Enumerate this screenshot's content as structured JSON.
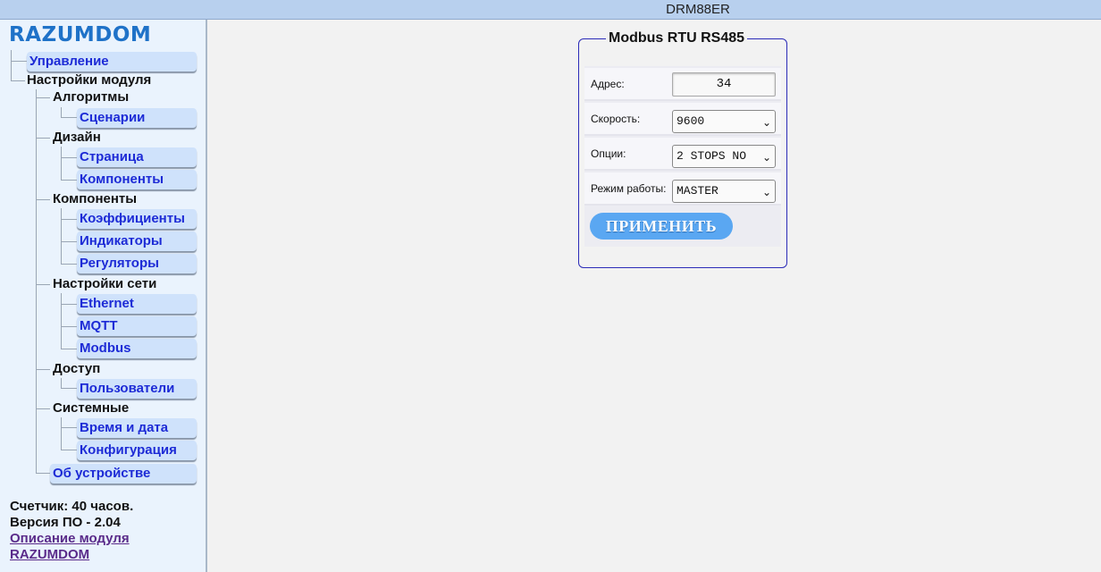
{
  "window": {
    "title": "DRM88ER"
  },
  "sidebar": {
    "logo": "RAZUMDOM",
    "items": {
      "control": "Управление",
      "module_settings": "Настройки модуля",
      "algorithms": "Алгоритмы",
      "scenarios": "Сценарии",
      "design": "Дизайн",
      "page": "Страница",
      "design_components": "Компоненты",
      "components": "Компоненты",
      "coefficients": "Коэффициенты",
      "indicators": "Индикаторы",
      "regulators": "Регуляторы",
      "network": "Настройки сети",
      "ethernet": "Ethernet",
      "mqtt": "MQTT",
      "modbus": "Modbus",
      "access": "Доступ",
      "users": "Пользователи",
      "system": "Системные",
      "datetime": "Время и дата",
      "configuration": "Конфигурация",
      "about": "Об устройстве"
    },
    "footer": {
      "counter": "Счетчик: 40 часов.",
      "version": "Версия ПО - 2.04",
      "link_line1": "Описание модуля",
      "link_line2": "RAZUMDOM"
    }
  },
  "panel": {
    "title": "Modbus RTU RS485",
    "address_label": "Адрес:",
    "address_value": "34",
    "speed_label": "Скорость:",
    "speed_value": "9600",
    "options_label": "Опции:",
    "options_value": "2 STOPS NO",
    "mode_label": "Режим работы:",
    "mode_value": "MASTER",
    "apply_label": "ПРИМЕНИТЬ"
  }
}
